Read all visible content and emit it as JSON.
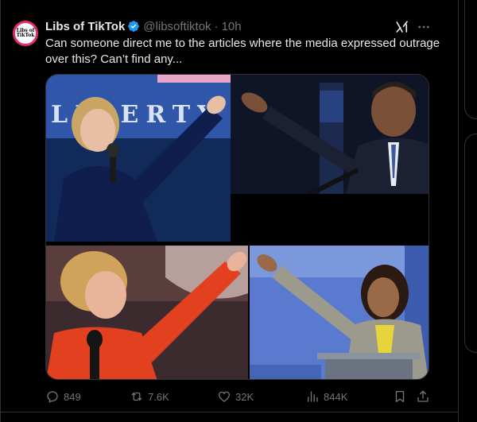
{
  "tweet": {
    "avatar_text": "Libs of TikTok",
    "display_name": "Libs of TikTok",
    "handle": "@libsoftiktok",
    "separator": "·",
    "time": "10h",
    "text": "Can someone direct me to the articles where the media expressed outrage over this? Can’t find any...",
    "media": {
      "photo_1_sign": "LIBERTY C",
      "photos": [
        "photo-top-left",
        "photo-top-right",
        "photo-bottom-left",
        "photo-bottom-right"
      ]
    },
    "actions": {
      "replies": "849",
      "reposts": "7.6K",
      "likes": "32K",
      "views": "844K"
    }
  },
  "colors": {
    "background": "#000000",
    "text": "#e7e9ea",
    "muted": "#71767b",
    "border": "#2f3336",
    "verified": "#1d9bf0",
    "avatar_ring": "#e52a6f"
  }
}
